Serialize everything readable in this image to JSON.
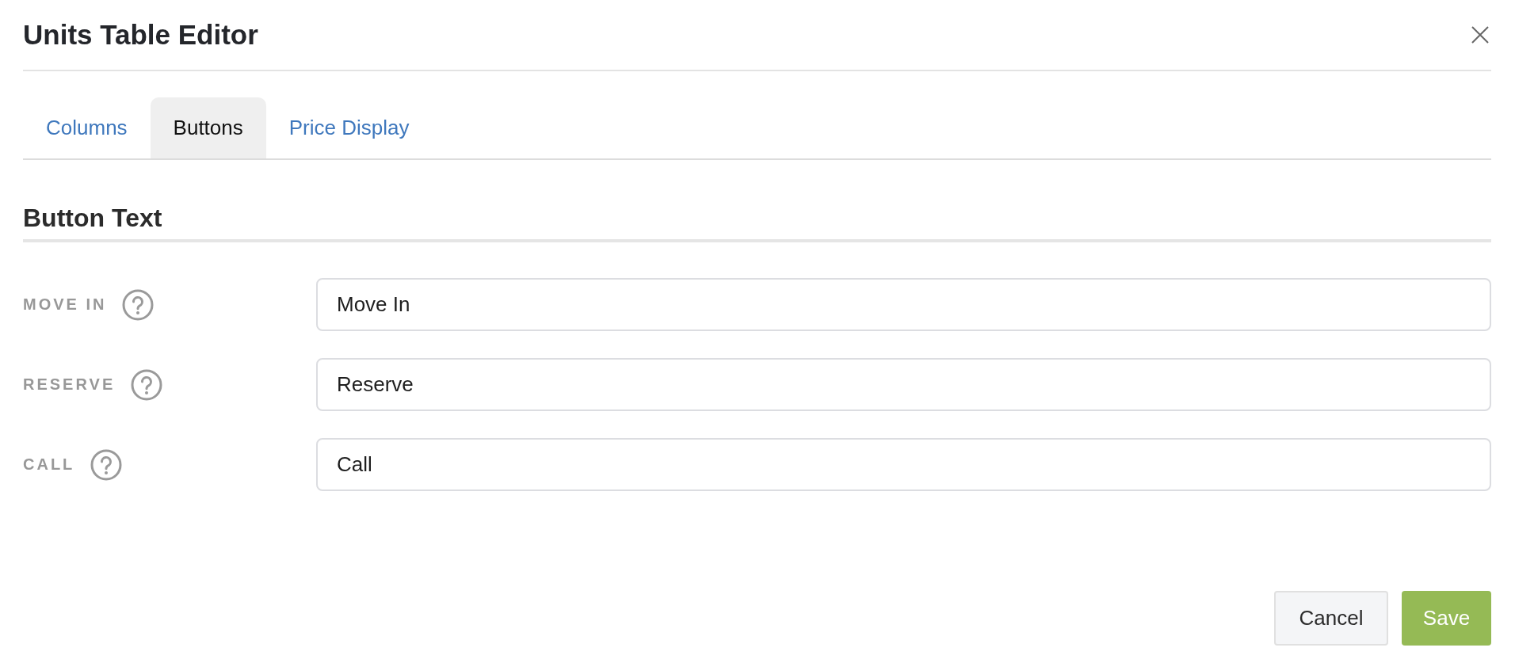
{
  "dialog": {
    "title": "Units Table Editor"
  },
  "tabs": [
    {
      "label": "Columns",
      "selected": false
    },
    {
      "label": "Buttons",
      "selected": true
    },
    {
      "label": "Price Display",
      "selected": false
    }
  ],
  "section": {
    "heading": "Button Text"
  },
  "fields": [
    {
      "label": "MOVE IN",
      "value": "Move In"
    },
    {
      "label": "RESERVE",
      "value": "Reserve"
    },
    {
      "label": "CALL",
      "value": "Call"
    }
  ],
  "buttons": [
    {
      "label": "Cancel",
      "kind": "secondary"
    },
    {
      "label": "Save",
      "kind": "primary"
    }
  ]
}
